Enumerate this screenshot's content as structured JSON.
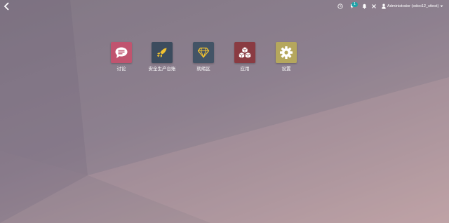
{
  "navbar": {
    "user_name": "Administrator (odoo12_sttest)",
    "chat_count": "1",
    "colors": {
      "badge": "#1fa3a8"
    },
    "icons": [
      "back-arrow-icon",
      "clock-icon",
      "chat-icon",
      "bell-icon",
      "close-icon",
      "user-icon",
      "caret-down-icon"
    ]
  },
  "apps": [
    {
      "label": "讨论",
      "icon": "speech-bubble-icon",
      "color": "#c0546f"
    },
    {
      "label": "安全生产台账",
      "icon": "rocket-icon",
      "color": "#3c4c5e"
    },
    {
      "label": "就绪区",
      "icon": "diamond-icon",
      "color": "#435466"
    },
    {
      "label": "应用",
      "icon": "cubes-icon",
      "color": "#8a3b42"
    },
    {
      "label": "设置",
      "icon": "gear-icon",
      "color": "#b5a75d"
    }
  ]
}
